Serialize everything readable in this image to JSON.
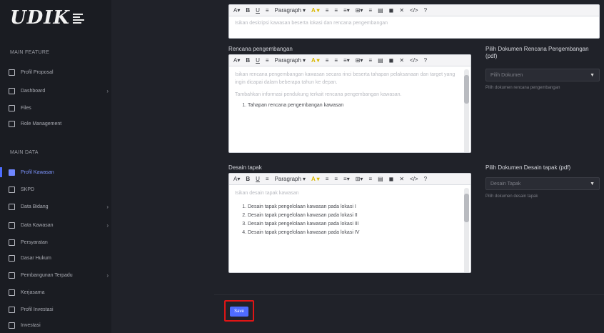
{
  "brand": {
    "logo_text": "UDIK"
  },
  "sidebar": {
    "section1_label": "MAIN FEATURE",
    "section2_label": "MAIN DATA",
    "group1": [
      {
        "label": "Profil Proposal",
        "icon": "grid-icon"
      },
      {
        "label": "Dashboard",
        "icon": "dashboard-icon",
        "chevron": true
      },
      {
        "label": "Files",
        "icon": "files-icon"
      },
      {
        "label": "Role Management",
        "icon": "role-icon"
      }
    ],
    "group2": [
      {
        "label": "Profil Kawasan",
        "icon": "profile-icon",
        "active": true
      },
      {
        "label": "SKPD",
        "icon": "grid-icon"
      },
      {
        "label": "Data Bidang",
        "icon": "grid-icon",
        "chevron": true
      },
      {
        "label": "Data Kawasan",
        "icon": "grid-icon",
        "chevron": true
      },
      {
        "label": "Persyaratan",
        "icon": "grid-icon"
      },
      {
        "label": "Dasar Hukum",
        "icon": "grid-icon"
      },
      {
        "label": "Pembangunan Terpadu",
        "icon": "grid-icon",
        "chevron": true
      },
      {
        "label": "Kerjasama",
        "icon": "grid-icon"
      },
      {
        "label": "Profil Investasi",
        "icon": "grid-icon"
      },
      {
        "label": "Investasi",
        "icon": "grid-icon"
      }
    ]
  },
  "toolbar": {
    "items": [
      "A",
      "B",
      "U",
      "≡",
      "Paragraph",
      "A",
      "≡",
      "≡",
      "≡",
      "⊞",
      "≡",
      "≡",
      "≡",
      "✕",
      "<>",
      "?"
    ]
  },
  "editor_top": {
    "placeholder": "Isikan deskripsi kawasan beserta lokasi dan rencana pengembangan"
  },
  "rencana": {
    "label": "Rencana pengembangan",
    "text": "Isikan rencana pengembangan kawasan secara rinci beserta tahapan pelaksanaan dan target yang ingin dicapai dalam beberapa tahun ke depan.",
    "text2": "Tambahkan informasi pendukung terkait rencana pengembangan kawasan.",
    "list_item": "Tahapan rencana pengembangan kawasan"
  },
  "desain": {
    "label": "Desain tapak",
    "placeholder": "Isikan desain tapak kawasan",
    "items": [
      "Desain tapak pengelolaan kawasan pada lokasi I",
      "Desain tapak pengelolaan kawasan pada lokasi II",
      "Desain tapak pengelolaan kawasan pada lokasi III",
      "Desain tapak pengelolaan kawasan pada lokasi IV"
    ]
  },
  "right": {
    "rencana_label": "Pilih Dokumen Rencana Pengembangan (pdf)",
    "rencana_select": "Pilih Dokumen",
    "rencana_helper": "Pilih dokumen rencana pengembangan",
    "desain_label": "Pilih Dokumen Desain tapak (pdf)",
    "desain_select": "Desain Tapak",
    "desain_helper": "Pilih dokumen desain tapak"
  },
  "actions": {
    "save_label": "Save"
  },
  "colors": {
    "accent": "#4e6bff",
    "highlight": "#e01515"
  }
}
